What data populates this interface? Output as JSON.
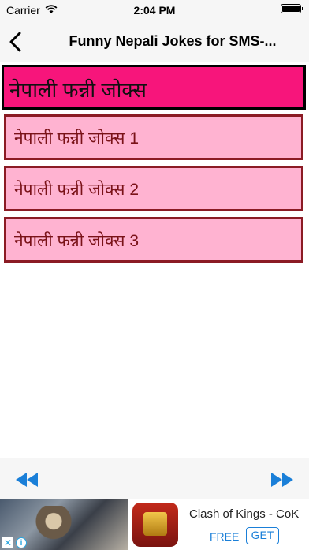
{
  "status_bar": {
    "carrier": "Carrier",
    "time": "2:04 PM"
  },
  "nav": {
    "title": "Funny Nepali Jokes for SMS-..."
  },
  "header": {
    "title": "नेपाली फन्नी जोक्स"
  },
  "list": {
    "items": [
      {
        "label": "नेपाली फन्नी जोक्स 1"
      },
      {
        "label": "नेपाली फन्नी जोक्स 2"
      },
      {
        "label": "नेपाली फन्नी जोक्स 3"
      }
    ]
  },
  "ad": {
    "title": "Clash of Kings - CoK",
    "price": "FREE",
    "get_label": "GET"
  },
  "colors": {
    "header_bg": "#f7157b",
    "item_bg": "#ffb3d1",
    "item_border": "#8b1b24",
    "accent": "#1a7fd8"
  }
}
